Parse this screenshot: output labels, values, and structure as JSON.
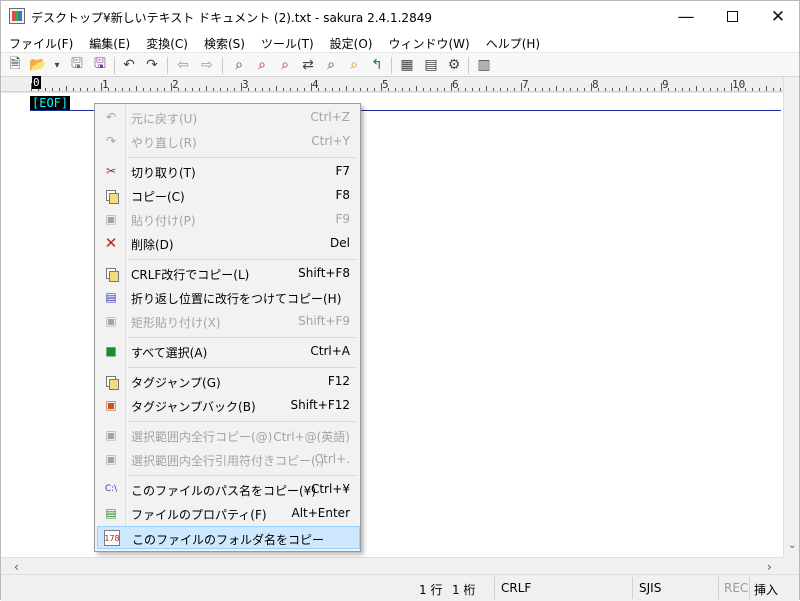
{
  "window": {
    "title": "デスクトップ¥新しいテキスト ドキュメント (2).txt - sakura 2.4.1.2849",
    "minimize": "—",
    "close": "✕"
  },
  "menubar": [
    "ファイル(F)",
    "編集(E)",
    "変換(C)",
    "検索(S)",
    "ツール(T)",
    "設定(O)",
    "ウィンドウ(W)",
    "ヘルプ(H)"
  ],
  "toolbar_icons": [
    "new-file-icon",
    "open-folder-icon",
    "dropdown-icon",
    "save-icon",
    "save-as-icon",
    "undo-icon",
    "redo-icon",
    "back-icon",
    "forward-icon",
    "search-icon",
    "search-next-icon",
    "search-previous-icon",
    "replace-icon",
    "tag-jump-icon",
    "compare-icon",
    "macro-icon",
    "grep-icon",
    "outline-icon",
    "options-icon"
  ],
  "ruler": {
    "labels": [
      "0",
      "1",
      "2",
      "3",
      "4",
      "5",
      "6",
      "7",
      "8",
      "9",
      "10"
    ]
  },
  "editor": {
    "eof": "[EOF]"
  },
  "context_menu": {
    "items": [
      {
        "label": "元に戻す(U)",
        "shortcut": "Ctrl+Z",
        "icon": "undo-icon",
        "disabled": true
      },
      {
        "label": "やり直し(R)",
        "shortcut": "Ctrl+Y",
        "icon": "redo-icon",
        "disabled": true
      },
      {
        "separator": true
      },
      {
        "label": "切り取り(T)",
        "shortcut": "F7",
        "icon": "cut-icon",
        "disabled": false
      },
      {
        "label": "コピー(C)",
        "shortcut": "F8",
        "icon": "copy-icon",
        "disabled": false
      },
      {
        "label": "貼り付け(P)",
        "shortcut": "F9",
        "icon": "paste-icon",
        "disabled": true
      },
      {
        "label": "削除(D)",
        "shortcut": "Del",
        "icon": "delete-icon",
        "disabled": false
      },
      {
        "separator": true
      },
      {
        "label": "CRLF改行でコピー(L)",
        "shortcut": "Shift+F8",
        "icon": "copy-crlf-icon",
        "disabled": false
      },
      {
        "label": "折り返し位置に改行をつけてコピー(H)",
        "shortcut": "",
        "icon": "copy-wrap-icon",
        "disabled": false
      },
      {
        "label": "矩形貼り付け(X)",
        "shortcut": "Shift+F9",
        "icon": "rectangle-paste-icon",
        "disabled": true
      },
      {
        "separator": true
      },
      {
        "label": "すべて選択(A)",
        "shortcut": "Ctrl+A",
        "icon": "select-all-icon",
        "disabled": false
      },
      {
        "separator": true
      },
      {
        "label": "タグジャンプ(G)",
        "shortcut": "F12",
        "icon": "tag-jump-icon",
        "disabled": false
      },
      {
        "label": "タグジャンプバック(B)",
        "shortcut": "Shift+F12",
        "icon": "tag-jump-back-icon",
        "disabled": false
      },
      {
        "separator": true
      },
      {
        "label": "選択範囲内全行コピー(@)",
        "shortcut": "Ctrl+@(英語)",
        "icon": "copy-lines-icon",
        "disabled": true
      },
      {
        "label": "選択範囲内全行引用符付きコピー(,)",
        "shortcut": "Ctrl+.",
        "icon": "quoted-copy-icon",
        "disabled": true
      },
      {
        "separator": true
      },
      {
        "label": "このファイルのパス名をコピー(¥)",
        "shortcut": "Ctrl+¥",
        "icon": "path-copy-icon",
        "disabled": false
      },
      {
        "label": "ファイルのプロパティ(F)",
        "shortcut": "Alt+Enter",
        "icon": "properties-icon",
        "disabled": false
      },
      {
        "label": "このファイルのフォルダ名をコピー",
        "shortcut": "",
        "icon": "folder-copy-icon",
        "disabled": false,
        "highlighted": true
      }
    ]
  },
  "status": {
    "line": "1 行",
    "column": "1 桁",
    "eol": "CRLF",
    "encoding": "SJIS",
    "rec": "REC",
    "mode": "挿入"
  }
}
